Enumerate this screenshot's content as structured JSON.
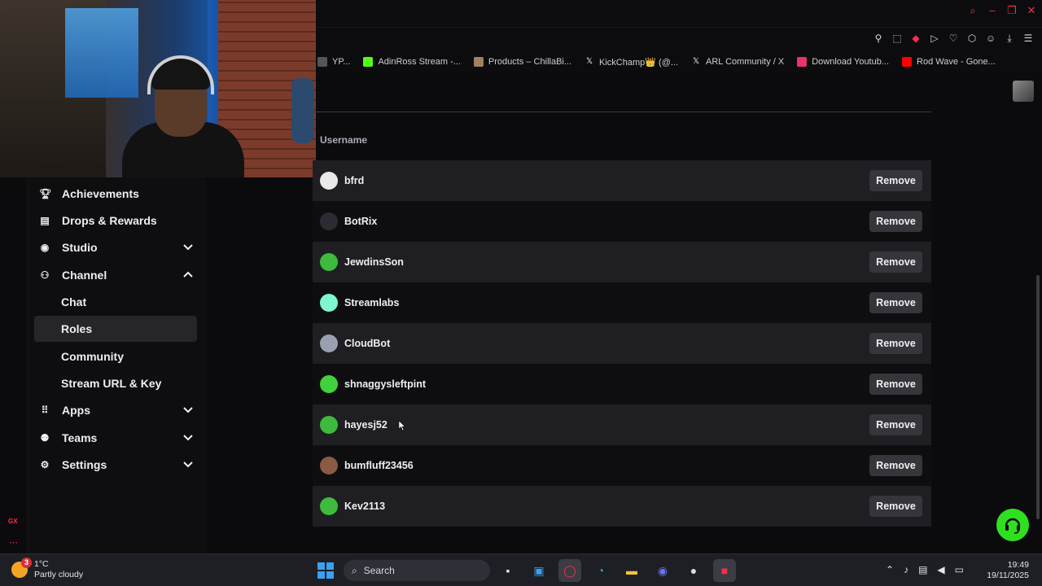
{
  "bookmarks": [
    {
      "label": "YP...",
      "icon": "page-icon",
      "color": "#555555"
    },
    {
      "label": "AdinRoss Stream -...",
      "icon": "kick-icon",
      "color": "#53fc18"
    },
    {
      "label": "Products – ChillaBi...",
      "icon": "shop-icon",
      "color": "#a08060"
    },
    {
      "label": "KickChamp👑 (@...",
      "icon": "x-icon",
      "color": "#ffffff"
    },
    {
      "label": "ARL Community / X",
      "icon": "x-icon",
      "color": "#ffffff"
    },
    {
      "label": "Download Youtub...",
      "icon": "download-icon",
      "color": "#e8336a"
    },
    {
      "label": "Rod Wave - Gone...",
      "icon": "youtube-icon",
      "color": "#ff0000"
    }
  ],
  "sidebar": {
    "items": [
      {
        "label": "Achievements",
        "icon": "trophy-icon",
        "expandable": false
      },
      {
        "label": "Drops & Rewards",
        "icon": "gift-icon",
        "expandable": false
      },
      {
        "label": "Studio",
        "icon": "camera-icon",
        "expandable": true,
        "expanded": false
      },
      {
        "label": "Channel",
        "icon": "user-group-icon",
        "expandable": true,
        "expanded": true
      },
      {
        "label": "Chat",
        "sub": true
      },
      {
        "label": "Roles",
        "sub": true,
        "active": true
      },
      {
        "label": "Community",
        "sub": true
      },
      {
        "label": "Stream URL & Key",
        "sub": true
      },
      {
        "label": "Apps",
        "icon": "grid-icon",
        "expandable": true,
        "expanded": false
      },
      {
        "label": "Teams",
        "icon": "team-icon",
        "expandable": true,
        "expanded": false
      },
      {
        "label": "Settings",
        "icon": "gear-icon",
        "expandable": true,
        "expanded": false
      }
    ]
  },
  "table": {
    "column_header": "Username",
    "remove_label": "Remove",
    "rows": [
      {
        "username": "bfrd",
        "avatar_color": "#e9e9e9"
      },
      {
        "username": "BotRix",
        "avatar_color": "#2b2b32"
      },
      {
        "username": "JewdinsSon",
        "avatar_color": "#3dbb3d"
      },
      {
        "username": "Streamlabs",
        "avatar_color": "#80f5d2"
      },
      {
        "username": "CloudBot",
        "avatar_color": "#9aa0b0"
      },
      {
        "username": "shnaggysleftpint",
        "avatar_color": "#41d13a"
      },
      {
        "username": "hayesj52",
        "avatar_color": "#3dbb3d"
      },
      {
        "username": "bumfluff23456",
        "avatar_color": "#8a5a45"
      },
      {
        "username": "Kev2113",
        "avatar_color": "#3dbb3d"
      }
    ]
  },
  "taskbar": {
    "weather_temp": "1°C",
    "weather_desc": "Partly cloudy",
    "weather_badge": "3",
    "search_label": "Search",
    "time": "19:49",
    "date": "19/11/2025"
  },
  "left_rail": {
    "gx_label": "GX"
  },
  "colors": {
    "accent": "#ff2b4a",
    "kick_green": "#2fe021",
    "row_alt": "#1f1f23"
  }
}
